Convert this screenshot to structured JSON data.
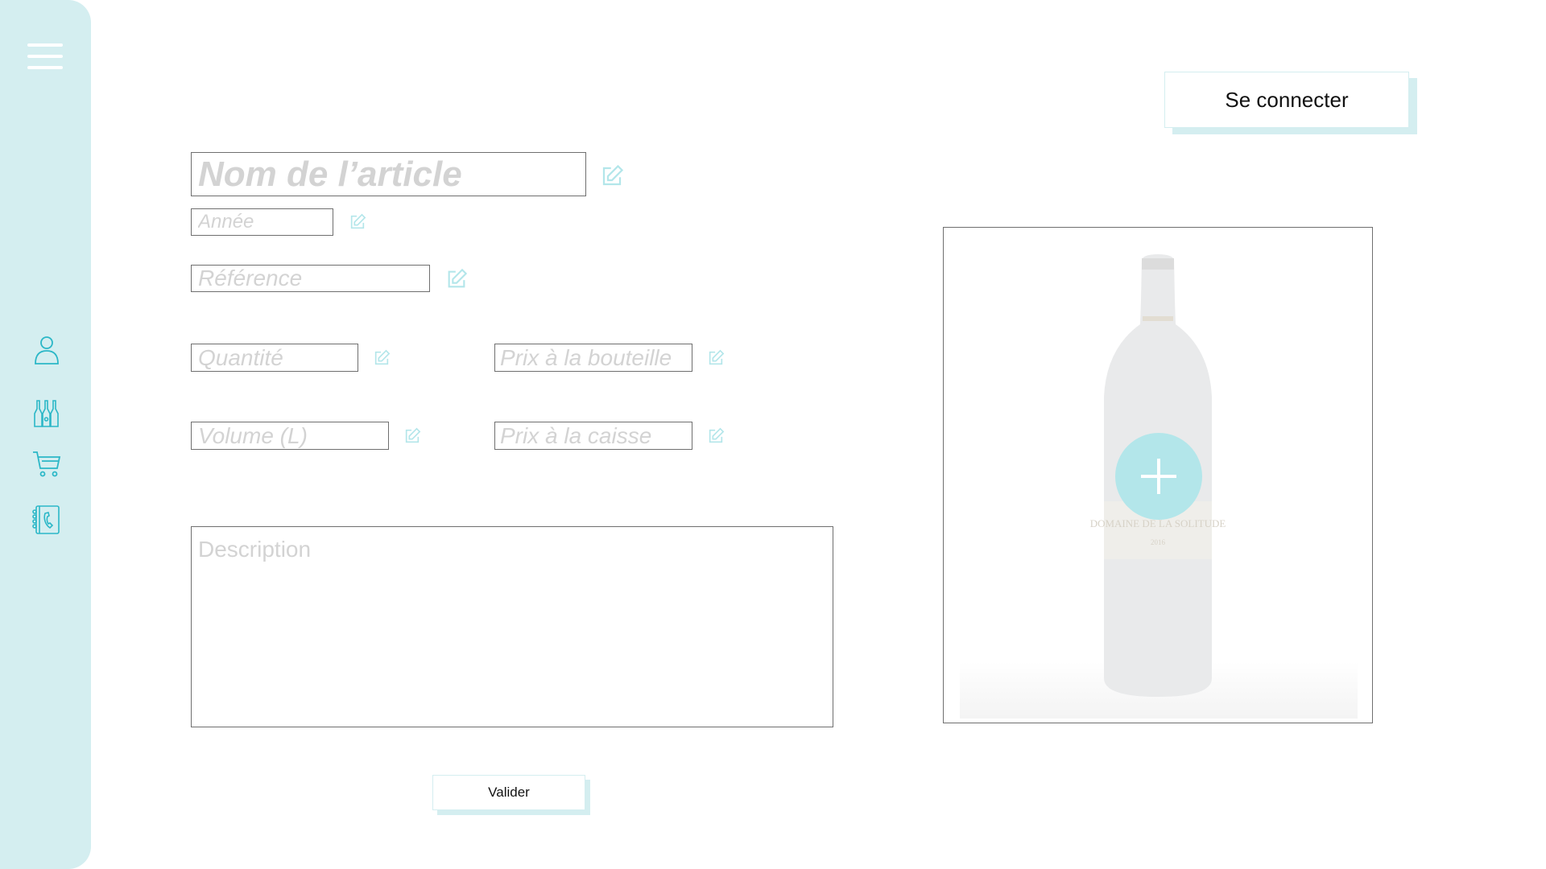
{
  "sidebar": {
    "menu_icon": "hamburger-menu-icon",
    "items": [
      {
        "icon": "user-icon"
      },
      {
        "icon": "wine-bottles-icon"
      },
      {
        "icon": "shopping-cart-icon"
      },
      {
        "icon": "contact-book-icon"
      }
    ]
  },
  "header": {
    "login_label": "Se connecter"
  },
  "form": {
    "name_placeholder": "Nom de l’article",
    "year_placeholder": "Année",
    "reference_placeholder": "Référence",
    "quantity_placeholder": "Quantité",
    "bottle_price_placeholder": "Prix à la bouteille",
    "volume_placeholder": "Volume (L)",
    "case_price_placeholder": "Prix à la caisse",
    "description_placeholder": "Description",
    "submit_label": "Valider"
  },
  "image_panel": {
    "label_text": "DOMAINE DE LA SOLITUDE",
    "label_year": "2016",
    "add_icon": "plus-icon"
  },
  "colors": {
    "accent": "#d4eef0",
    "accent_strong": "#2bb7c7",
    "add_button": "#b3e6ea"
  }
}
